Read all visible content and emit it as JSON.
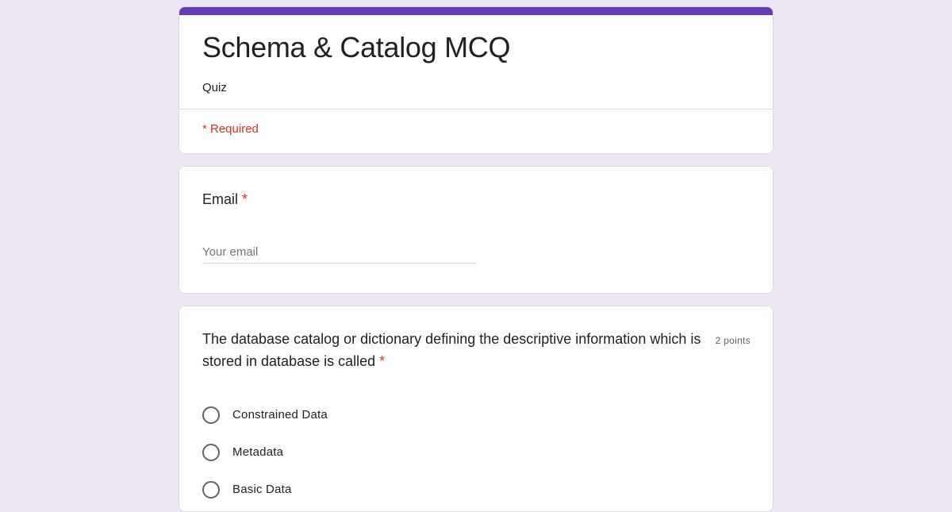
{
  "form": {
    "title": "Schema & Catalog MCQ",
    "subtitle": "Quiz",
    "required_note": "* Required",
    "accent_color": "#673ab7",
    "background_color": "#ede7f6"
  },
  "email_question": {
    "label": "Email",
    "required_marker": "*",
    "placeholder": "Your email",
    "value": ""
  },
  "question_1": {
    "text": "The database catalog or dictionary defining the descriptive information which is stored in database is called",
    "required_marker": "*",
    "points": "2 points",
    "options": [
      {
        "label": "Constrained Data",
        "icon": "radio-unchecked"
      },
      {
        "label": "Metadata",
        "icon": "radio-unchecked"
      },
      {
        "label": "Basic Data",
        "icon": "radio-unchecked"
      }
    ]
  }
}
